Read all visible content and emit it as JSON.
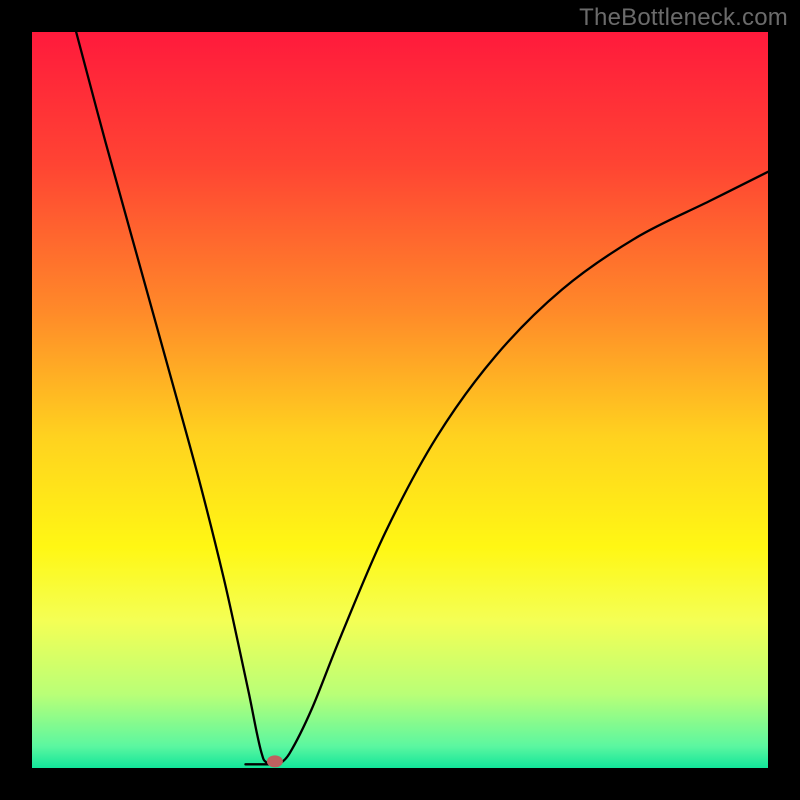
{
  "watermark": "TheBottleneck.com",
  "chart_data": {
    "type": "line",
    "title": "",
    "xlabel": "",
    "ylabel": "",
    "x_range": [
      0,
      100
    ],
    "y_range": [
      0,
      100
    ],
    "gradient_stops": [
      {
        "offset": 0,
        "color": "#ff1a3c"
      },
      {
        "offset": 18,
        "color": "#ff4433"
      },
      {
        "offset": 38,
        "color": "#ff8a29"
      },
      {
        "offset": 55,
        "color": "#ffd21f"
      },
      {
        "offset": 70,
        "color": "#fff714"
      },
      {
        "offset": 80,
        "color": "#f4ff55"
      },
      {
        "offset": 90,
        "color": "#b9ff77"
      },
      {
        "offset": 97,
        "color": "#5cf7a0"
      },
      {
        "offset": 100,
        "color": "#12e59a"
      }
    ],
    "series": [
      {
        "name": "bottleneck-curve",
        "x": [
          6,
          10,
          15,
          20,
          23,
          26,
          28,
          29.5,
          30.5,
          31.2,
          31.8,
          33.5,
          35,
          38,
          42,
          48,
          55,
          63,
          72,
          82,
          92,
          100
        ],
        "values": [
          100,
          85,
          67,
          49,
          38,
          26,
          17,
          10,
          5,
          2,
          0.8,
          0.5,
          2,
          8,
          18,
          32,
          45,
          56,
          65,
          72,
          77,
          81
        ]
      }
    ],
    "flat_segment": {
      "x0": 29.0,
      "x1": 33.5,
      "y": 0.5
    },
    "marker": {
      "x": 33.0,
      "y": 0.9
    },
    "curve_stroke": "#000000",
    "curve_width": 2.3
  }
}
